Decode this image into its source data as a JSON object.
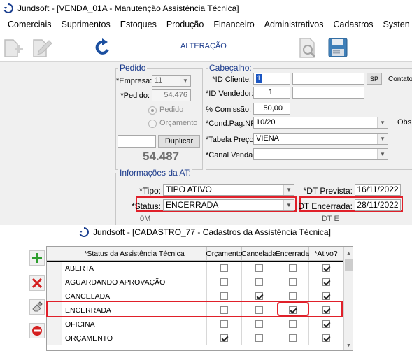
{
  "window1": {
    "title": "Jundsoft - [VENDA_01A - Manutenção Assistência Técnica]",
    "menu": [
      "Comerciais",
      "Suprimentos",
      "Estoques",
      "Produção",
      "Financeiro",
      "Administrativos",
      "Cadastros",
      "Systen"
    ],
    "toolbar": {
      "mode_label": "ALTERAÇÃO"
    },
    "pedido": {
      "legend": "Pedido",
      "empresa_label": "*Empresa:",
      "empresa_value": "11",
      "pedido_label": "*Pedido:",
      "pedido_value": "54.476",
      "radio_pedido": "Pedido",
      "radio_orcamento": "Orçamento",
      "duplicar_label": "Duplicar",
      "big_number": "54.487"
    },
    "cabecalho": {
      "legend": "Cabeçalho:",
      "id_cliente_label": "*ID Cliente:",
      "id_cliente_value": "1",
      "sp_label": "SP",
      "contato_label": "Contato",
      "id_vendedor_label": "*ID Vendedor:",
      "id_vendedor_value": "1",
      "comissao_label": "% Comissão:",
      "comissao_value": "50,00",
      "cond_pag_label": "*Cond.Pag.NF:",
      "cond_pag_value": "10/20",
      "obs_label": "Obs",
      "tabela_preco_label": "*Tabela Preço:",
      "tabela_preco_value": "VIENA",
      "canal_vendas_label": "*Canal Vendas:",
      "canal_vendas_value": ""
    },
    "informacoes": {
      "legend": "Informações da AT:",
      "tipo_label": "*Tipo:",
      "tipo_value": "TIPO ATIVO",
      "status_label": "*Status:",
      "status_value": "ENCERRADA",
      "dt_prevista_label": "*DT Prevista:",
      "dt_prevista_value": "16/11/2022",
      "dt_encerrada_label": "DT Encerrada:",
      "dt_encerrada_value": "28/11/2022",
      "partial_label": "DT E",
      "partial_value": "0M"
    }
  },
  "window2": {
    "title": "Jundsoft - [CADASTRO_77 - Cadastros da Assistência Técnica]",
    "columns": [
      "*Status da Assistência Técnica",
      "Orçamento",
      "Cancelada",
      "Encerrada",
      "*Ativo?"
    ],
    "rows": [
      {
        "name": "ABERTA",
        "orcamento": false,
        "cancelada": false,
        "encerrada": false,
        "ativo": true
      },
      {
        "name": "AGUARDANDO APROVAÇÃO",
        "orcamento": false,
        "cancelada": false,
        "encerrada": false,
        "ativo": true
      },
      {
        "name": "CANCELADA",
        "orcamento": false,
        "cancelada": true,
        "encerrada": false,
        "ativo": true
      },
      {
        "name": "ENCERRADA",
        "orcamento": false,
        "cancelada": false,
        "encerrada": true,
        "ativo": true
      },
      {
        "name": "OFICINA",
        "orcamento": false,
        "cancelada": false,
        "encerrada": false,
        "ativo": true
      },
      {
        "name": "ORÇAMENTO",
        "orcamento": true,
        "cancelada": false,
        "encerrada": false,
        "ativo": true
      }
    ]
  },
  "colors": {
    "highlight": "#e0202a",
    "accent_blue": "#1a3a8c",
    "add_green": "#2e9e2e",
    "delete_red": "#d42020"
  }
}
